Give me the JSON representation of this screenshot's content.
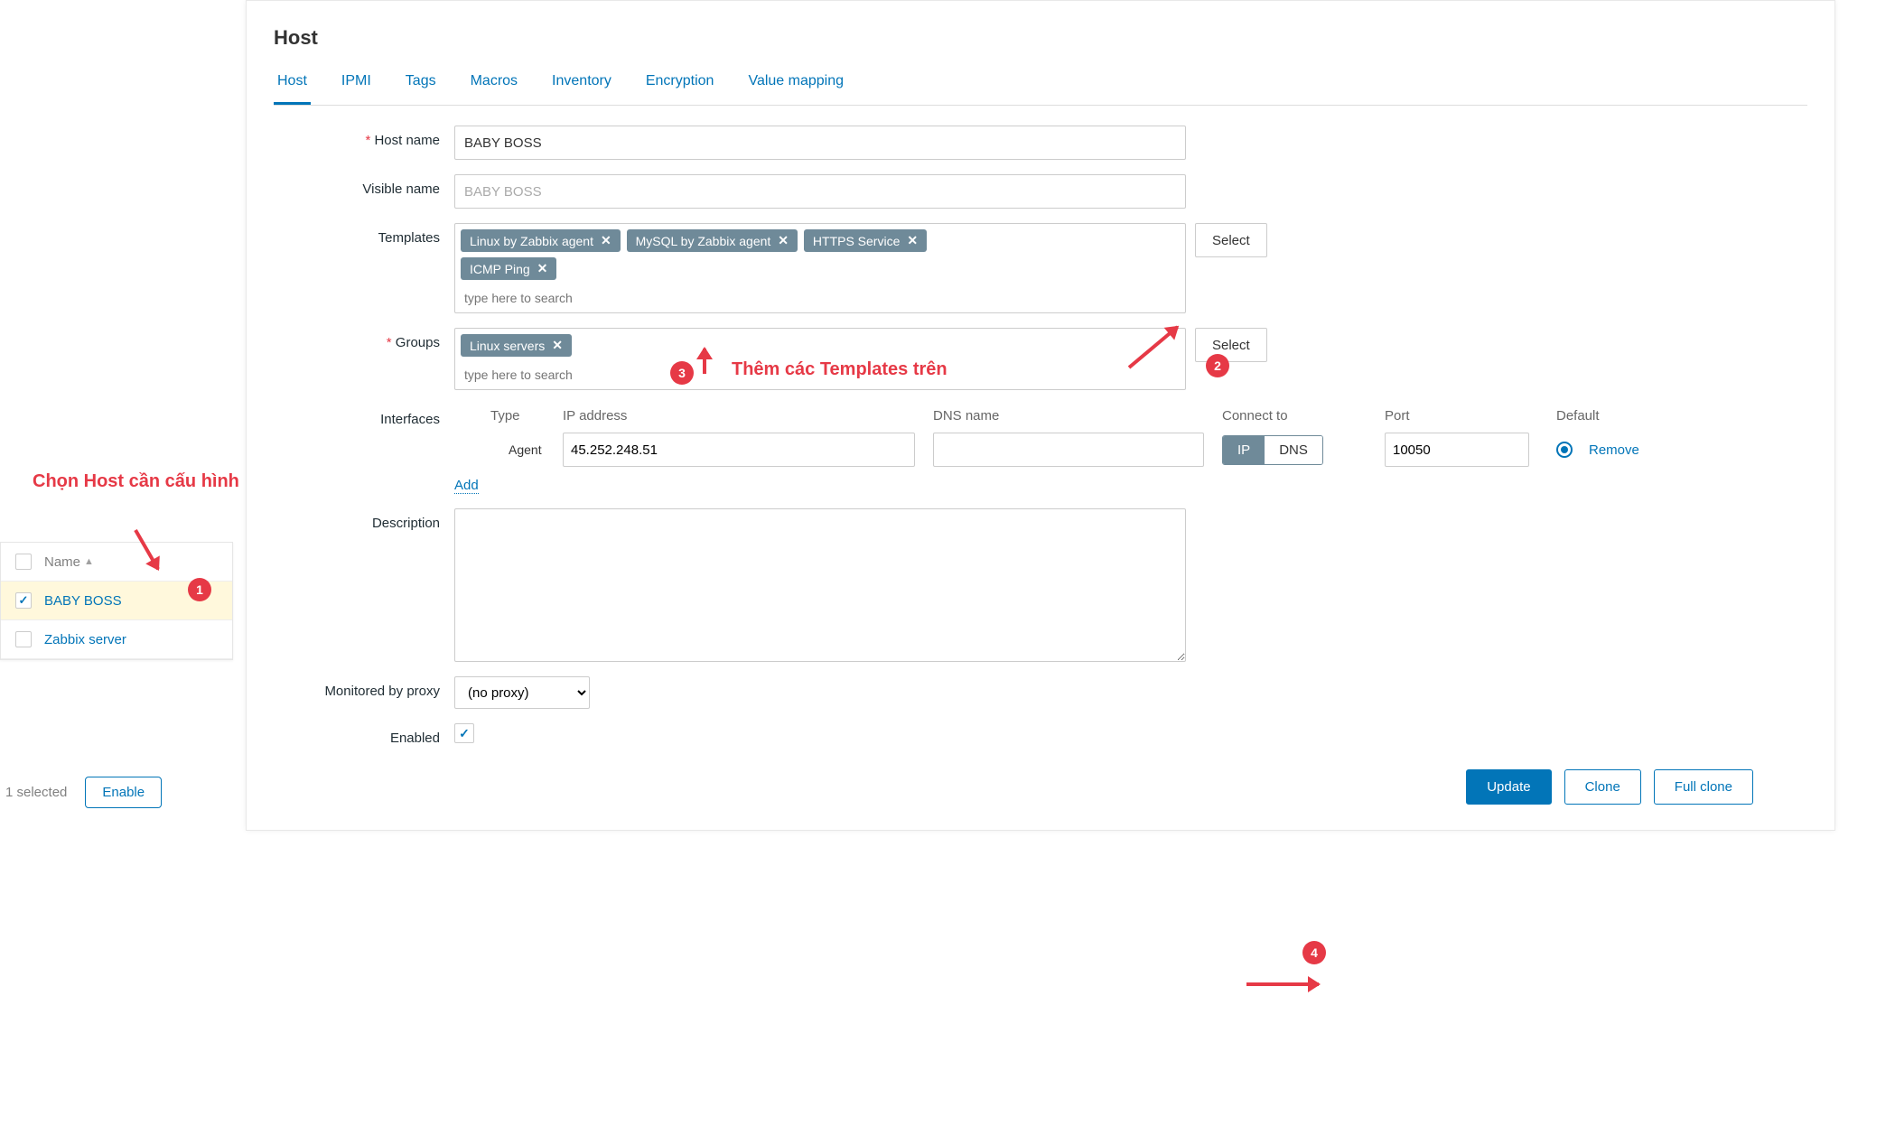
{
  "annotations": {
    "choose_host": "Chọn Host cần cấu hình",
    "add_templates": "Thêm các Templates trên",
    "b1": "1",
    "b2": "2",
    "b3": "3",
    "b4": "4"
  },
  "sidebar": {
    "col_name": "Name",
    "hosts": [
      {
        "name": "BABY BOSS",
        "checked": true,
        "selected": true
      },
      {
        "name": "Zabbix server",
        "checked": false,
        "selected": false
      }
    ],
    "selected_text": "1 selected",
    "enable_label": "Enable"
  },
  "modal": {
    "title": "Host",
    "tabs": [
      "Host",
      "IPMI",
      "Tags",
      "Macros",
      "Inventory",
      "Encryption",
      "Value mapping"
    ],
    "active_tab": "Host",
    "labels": {
      "host_name": "Host name",
      "visible_name": "Visible name",
      "templates": "Templates",
      "groups": "Groups",
      "interfaces": "Interfaces",
      "description": "Description",
      "monitored_by_proxy": "Monitored by proxy",
      "enabled": "Enabled"
    },
    "values": {
      "host_name": "BABY BOSS",
      "visible_name_placeholder": "BABY BOSS",
      "templates": [
        "Linux by Zabbix agent",
        "MySQL by Zabbix agent",
        "HTTPS Service",
        "ICMP Ping"
      ],
      "template_search_placeholder": "type here to search",
      "groups": [
        "Linux servers"
      ],
      "group_search_placeholder": "type here to search",
      "proxy": "(no proxy)",
      "enabled": true
    },
    "select_label": "Select",
    "interfaces": {
      "headers": {
        "type": "Type",
        "ip": "IP address",
        "dns": "DNS name",
        "connect_to": "Connect to",
        "port": "Port",
        "default": "Default"
      },
      "rows": [
        {
          "type": "Agent",
          "ip": "45.252.248.51",
          "dns": "",
          "connect_to": "IP",
          "connect_options": {
            "ip": "IP",
            "dns": "DNS"
          },
          "port": "10050",
          "is_default": true
        }
      ],
      "add_label": "Add",
      "remove_label": "Remove"
    },
    "footer": {
      "update": "Update",
      "clone": "Clone",
      "full_clone": "Full clone"
    }
  }
}
